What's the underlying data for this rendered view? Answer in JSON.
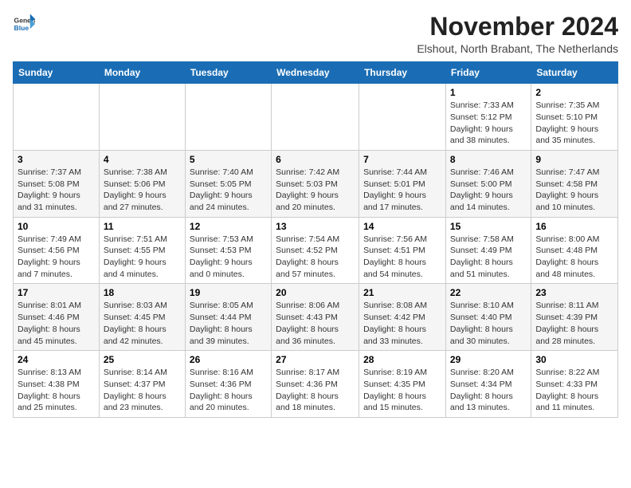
{
  "logo": {
    "general": "General",
    "blue": "Blue"
  },
  "header": {
    "month_title": "November 2024",
    "location": "Elshout, North Brabant, The Netherlands"
  },
  "weekdays": [
    "Sunday",
    "Monday",
    "Tuesday",
    "Wednesday",
    "Thursday",
    "Friday",
    "Saturday"
  ],
  "weeks": [
    [
      {
        "day": "",
        "info": ""
      },
      {
        "day": "",
        "info": ""
      },
      {
        "day": "",
        "info": ""
      },
      {
        "day": "",
        "info": ""
      },
      {
        "day": "",
        "info": ""
      },
      {
        "day": "1",
        "info": "Sunrise: 7:33 AM\nSunset: 5:12 PM\nDaylight: 9 hours and 38 minutes."
      },
      {
        "day": "2",
        "info": "Sunrise: 7:35 AM\nSunset: 5:10 PM\nDaylight: 9 hours and 35 minutes."
      }
    ],
    [
      {
        "day": "3",
        "info": "Sunrise: 7:37 AM\nSunset: 5:08 PM\nDaylight: 9 hours and 31 minutes."
      },
      {
        "day": "4",
        "info": "Sunrise: 7:38 AM\nSunset: 5:06 PM\nDaylight: 9 hours and 27 minutes."
      },
      {
        "day": "5",
        "info": "Sunrise: 7:40 AM\nSunset: 5:05 PM\nDaylight: 9 hours and 24 minutes."
      },
      {
        "day": "6",
        "info": "Sunrise: 7:42 AM\nSunset: 5:03 PM\nDaylight: 9 hours and 20 minutes."
      },
      {
        "day": "7",
        "info": "Sunrise: 7:44 AM\nSunset: 5:01 PM\nDaylight: 9 hours and 17 minutes."
      },
      {
        "day": "8",
        "info": "Sunrise: 7:46 AM\nSunset: 5:00 PM\nDaylight: 9 hours and 14 minutes."
      },
      {
        "day": "9",
        "info": "Sunrise: 7:47 AM\nSunset: 4:58 PM\nDaylight: 9 hours and 10 minutes."
      }
    ],
    [
      {
        "day": "10",
        "info": "Sunrise: 7:49 AM\nSunset: 4:56 PM\nDaylight: 9 hours and 7 minutes."
      },
      {
        "day": "11",
        "info": "Sunrise: 7:51 AM\nSunset: 4:55 PM\nDaylight: 9 hours and 4 minutes."
      },
      {
        "day": "12",
        "info": "Sunrise: 7:53 AM\nSunset: 4:53 PM\nDaylight: 9 hours and 0 minutes."
      },
      {
        "day": "13",
        "info": "Sunrise: 7:54 AM\nSunset: 4:52 PM\nDaylight: 8 hours and 57 minutes."
      },
      {
        "day": "14",
        "info": "Sunrise: 7:56 AM\nSunset: 4:51 PM\nDaylight: 8 hours and 54 minutes."
      },
      {
        "day": "15",
        "info": "Sunrise: 7:58 AM\nSunset: 4:49 PM\nDaylight: 8 hours and 51 minutes."
      },
      {
        "day": "16",
        "info": "Sunrise: 8:00 AM\nSunset: 4:48 PM\nDaylight: 8 hours and 48 minutes."
      }
    ],
    [
      {
        "day": "17",
        "info": "Sunrise: 8:01 AM\nSunset: 4:46 PM\nDaylight: 8 hours and 45 minutes."
      },
      {
        "day": "18",
        "info": "Sunrise: 8:03 AM\nSunset: 4:45 PM\nDaylight: 8 hours and 42 minutes."
      },
      {
        "day": "19",
        "info": "Sunrise: 8:05 AM\nSunset: 4:44 PM\nDaylight: 8 hours and 39 minutes."
      },
      {
        "day": "20",
        "info": "Sunrise: 8:06 AM\nSunset: 4:43 PM\nDaylight: 8 hours and 36 minutes."
      },
      {
        "day": "21",
        "info": "Sunrise: 8:08 AM\nSunset: 4:42 PM\nDaylight: 8 hours and 33 minutes."
      },
      {
        "day": "22",
        "info": "Sunrise: 8:10 AM\nSunset: 4:40 PM\nDaylight: 8 hours and 30 minutes."
      },
      {
        "day": "23",
        "info": "Sunrise: 8:11 AM\nSunset: 4:39 PM\nDaylight: 8 hours and 28 minutes."
      }
    ],
    [
      {
        "day": "24",
        "info": "Sunrise: 8:13 AM\nSunset: 4:38 PM\nDaylight: 8 hours and 25 minutes."
      },
      {
        "day": "25",
        "info": "Sunrise: 8:14 AM\nSunset: 4:37 PM\nDaylight: 8 hours and 23 minutes."
      },
      {
        "day": "26",
        "info": "Sunrise: 8:16 AM\nSunset: 4:36 PM\nDaylight: 8 hours and 20 minutes."
      },
      {
        "day": "27",
        "info": "Sunrise: 8:17 AM\nSunset: 4:36 PM\nDaylight: 8 hours and 18 minutes."
      },
      {
        "day": "28",
        "info": "Sunrise: 8:19 AM\nSunset: 4:35 PM\nDaylight: 8 hours and 15 minutes."
      },
      {
        "day": "29",
        "info": "Sunrise: 8:20 AM\nSunset: 4:34 PM\nDaylight: 8 hours and 13 minutes."
      },
      {
        "day": "30",
        "info": "Sunrise: 8:22 AM\nSunset: 4:33 PM\nDaylight: 8 hours and 11 minutes."
      }
    ]
  ]
}
